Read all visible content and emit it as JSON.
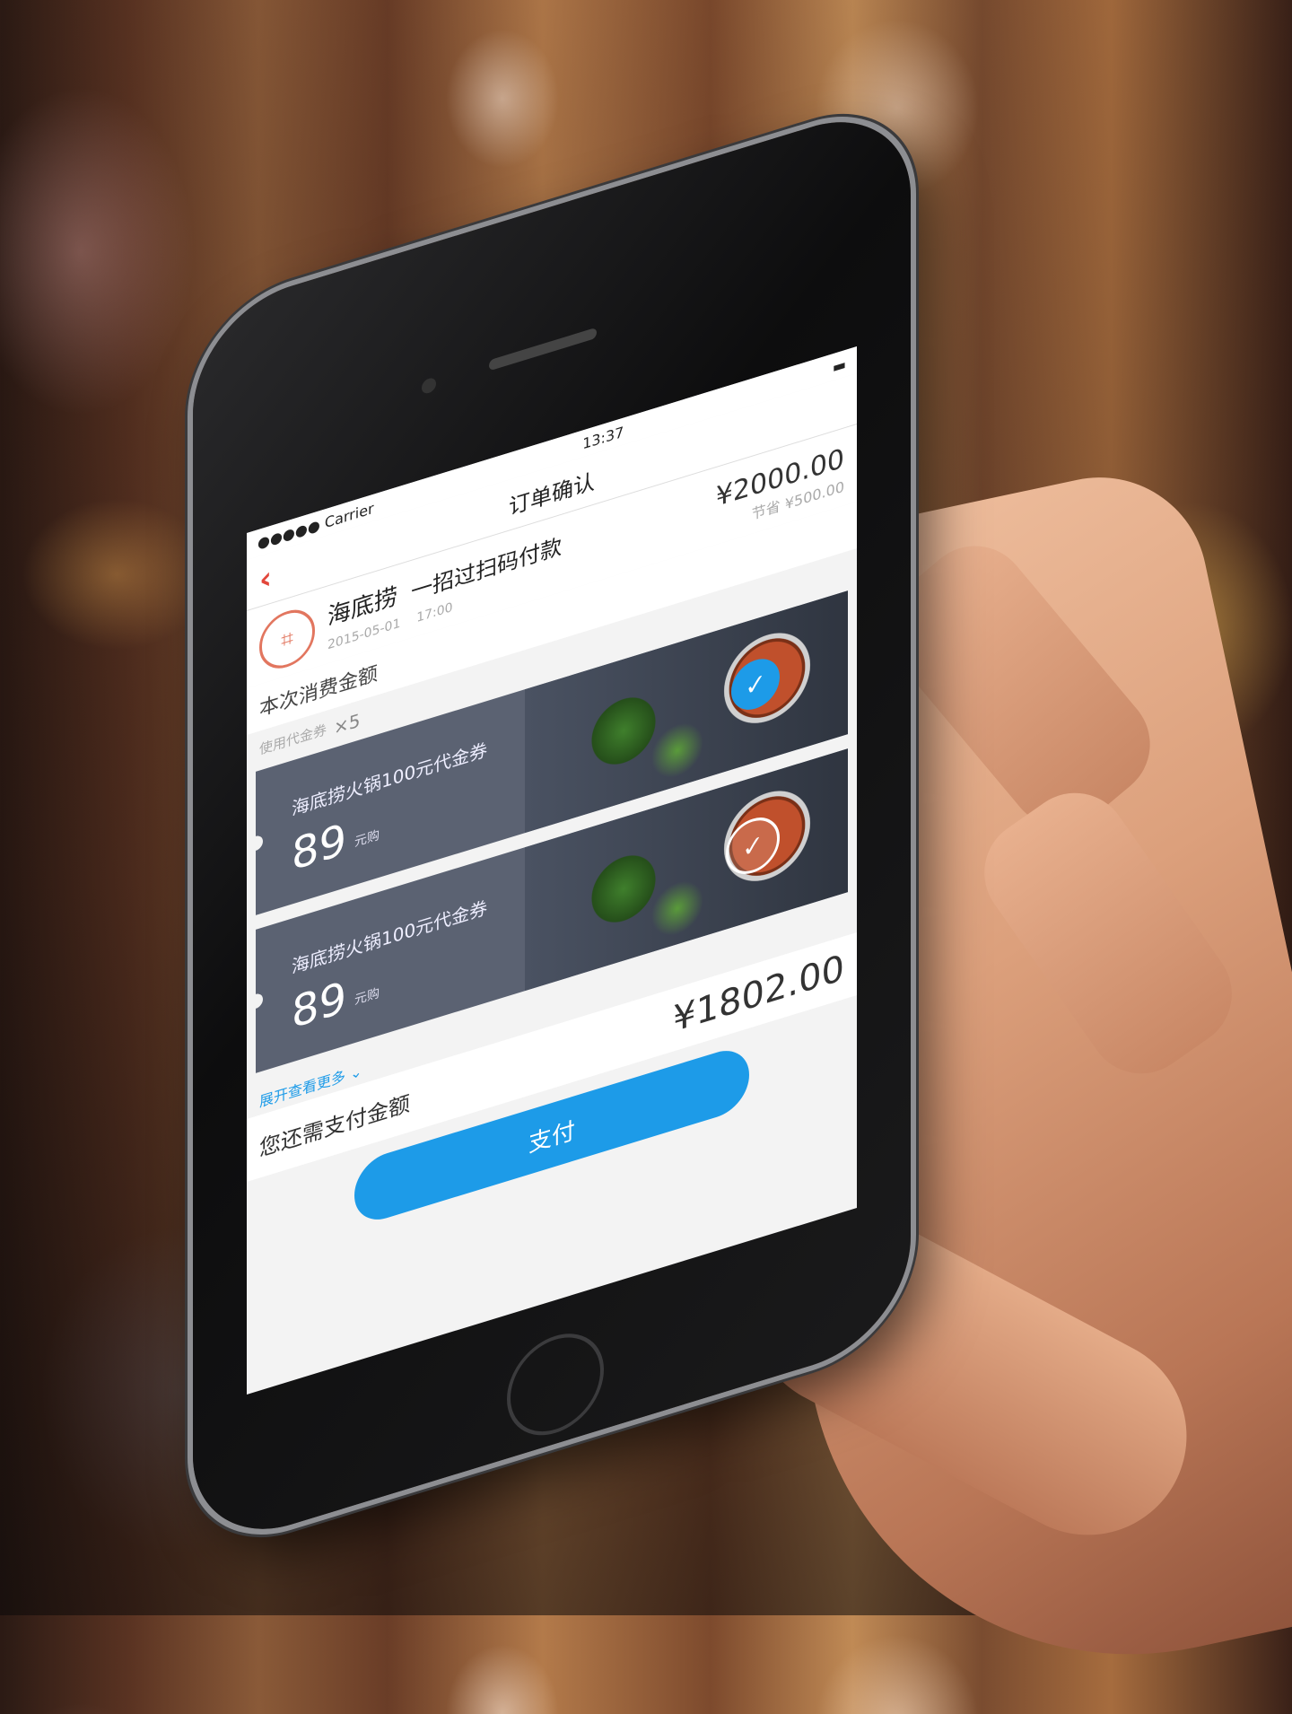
{
  "status": {
    "carrier": "●●●●● Carrier",
    "time": "13:37"
  },
  "nav": {
    "title": "订单确认",
    "back_icon": "chevron-left-icon"
  },
  "order": {
    "merchant": "海底捞",
    "slogan": "一招过扫码付款",
    "date": "2015-05-01",
    "time": "17:00",
    "amount": "¥2000.00",
    "saving_label": "节省",
    "saving": "¥500.00",
    "consume_label": "本次消费金额"
  },
  "coupons": {
    "header_label": "使用代金券",
    "count": "×5",
    "items": [
      {
        "title": "海底捞火锅100元代金券",
        "price": "89",
        "unit": "元购",
        "selected": true
      },
      {
        "title": "海底捞火锅100元代金券",
        "price": "89",
        "unit": "元购",
        "selected": false
      }
    ],
    "expand_label": "展开查看更多"
  },
  "payment": {
    "label": "您还需支付金额",
    "amount": "¥1802.00",
    "button": "支付"
  },
  "colors": {
    "accent": "#1d9be8",
    "back": "#e2463b",
    "badge": "#e2765f"
  }
}
